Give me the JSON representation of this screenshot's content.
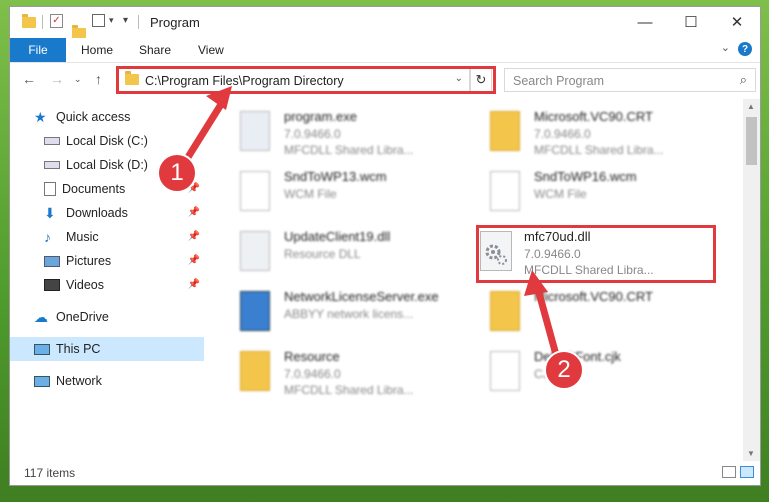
{
  "window": {
    "title": "Program"
  },
  "ribbon": {
    "file": "File",
    "home": "Home",
    "share": "Share",
    "view": "View"
  },
  "address": {
    "path": "C:\\Program Files\\Program Directory",
    "search_placeholder": "Search Program"
  },
  "sidebar": {
    "items": [
      {
        "label": "Quick access",
        "icon": "star-icon"
      },
      {
        "label": "Local Disk (C:)",
        "icon": "drive-icon"
      },
      {
        "label": "Local Disk (D:)",
        "icon": "drive-icon"
      },
      {
        "label": "Documents",
        "icon": "documents-icon"
      },
      {
        "label": "Downloads",
        "icon": "download-icon"
      },
      {
        "label": "Music",
        "icon": "music-icon"
      },
      {
        "label": "Pictures",
        "icon": "pictures-icon"
      },
      {
        "label": "Videos",
        "icon": "videos-icon"
      },
      {
        "label": "OneDrive",
        "icon": "cloud-icon"
      },
      {
        "label": "This PC",
        "icon": "pc-icon"
      },
      {
        "label": "Network",
        "icon": "network-icon"
      }
    ]
  },
  "files": [
    {
      "name": "program.exe",
      "line2": "7.0.9466.0",
      "line3": "MFCDLL Shared Libra..."
    },
    {
      "name": "Microsoft.VC90.CRT",
      "line2": "7.0.9466.0",
      "line3": "MFCDLL Shared Libra..."
    },
    {
      "name": "SndToWP13.wcm",
      "line2": "WCM File",
      "line3": ""
    },
    {
      "name": "SndToWP16.wcm",
      "line2": "WCM File",
      "line3": ""
    },
    {
      "name": "UpdateClient19.dll",
      "line2": "Resource DLL",
      "line3": ""
    },
    {
      "name": "NetworkLicenseServer.exe",
      "line2": "ABBYY network licens...",
      "line3": ""
    },
    {
      "name": "Microsoft.VC90.CRT",
      "line2": "",
      "line3": ""
    },
    {
      "name": "Resource",
      "line2": "7.0.9466.0",
      "line3": "MFCDLL Shared Libra..."
    },
    {
      "name": "DefaultFont.cjk",
      "line2": "CJK",
      "line3": ""
    }
  ],
  "selected_file": {
    "name": "mfc70ud.dll",
    "version": "7.0.9466.0",
    "description": "MFCDLL Shared Libra..."
  },
  "status": {
    "items": "117 items"
  },
  "annotations": {
    "badge1": "1",
    "badge2": "2",
    "color": "#e0393e"
  }
}
